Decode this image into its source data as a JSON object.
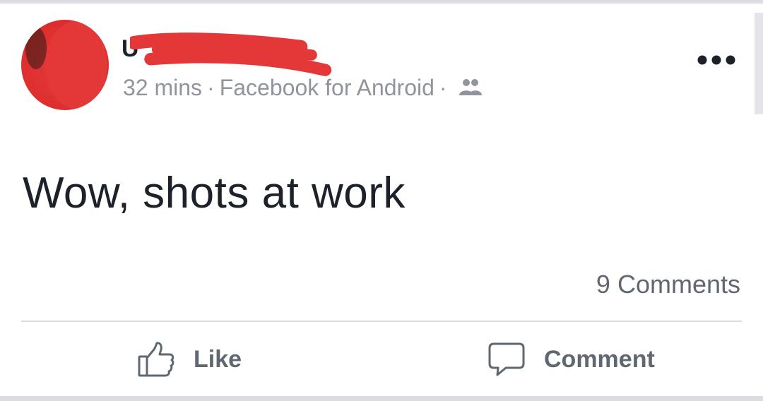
{
  "post": {
    "author_initial": "U",
    "timestamp": "32 mins",
    "source": "Facebook for Android",
    "separator": "·",
    "audience_icon": "friends-icon",
    "text": "Wow, shots at work",
    "comment_count": "9 Comments"
  },
  "actions": {
    "like_label": "Like",
    "comment_label": "Comment"
  },
  "colors": {
    "primary_text": "#1d2129",
    "secondary_text": "#90949c",
    "action_text": "#606770",
    "redaction": "#e43838",
    "divider": "#dadde1"
  }
}
